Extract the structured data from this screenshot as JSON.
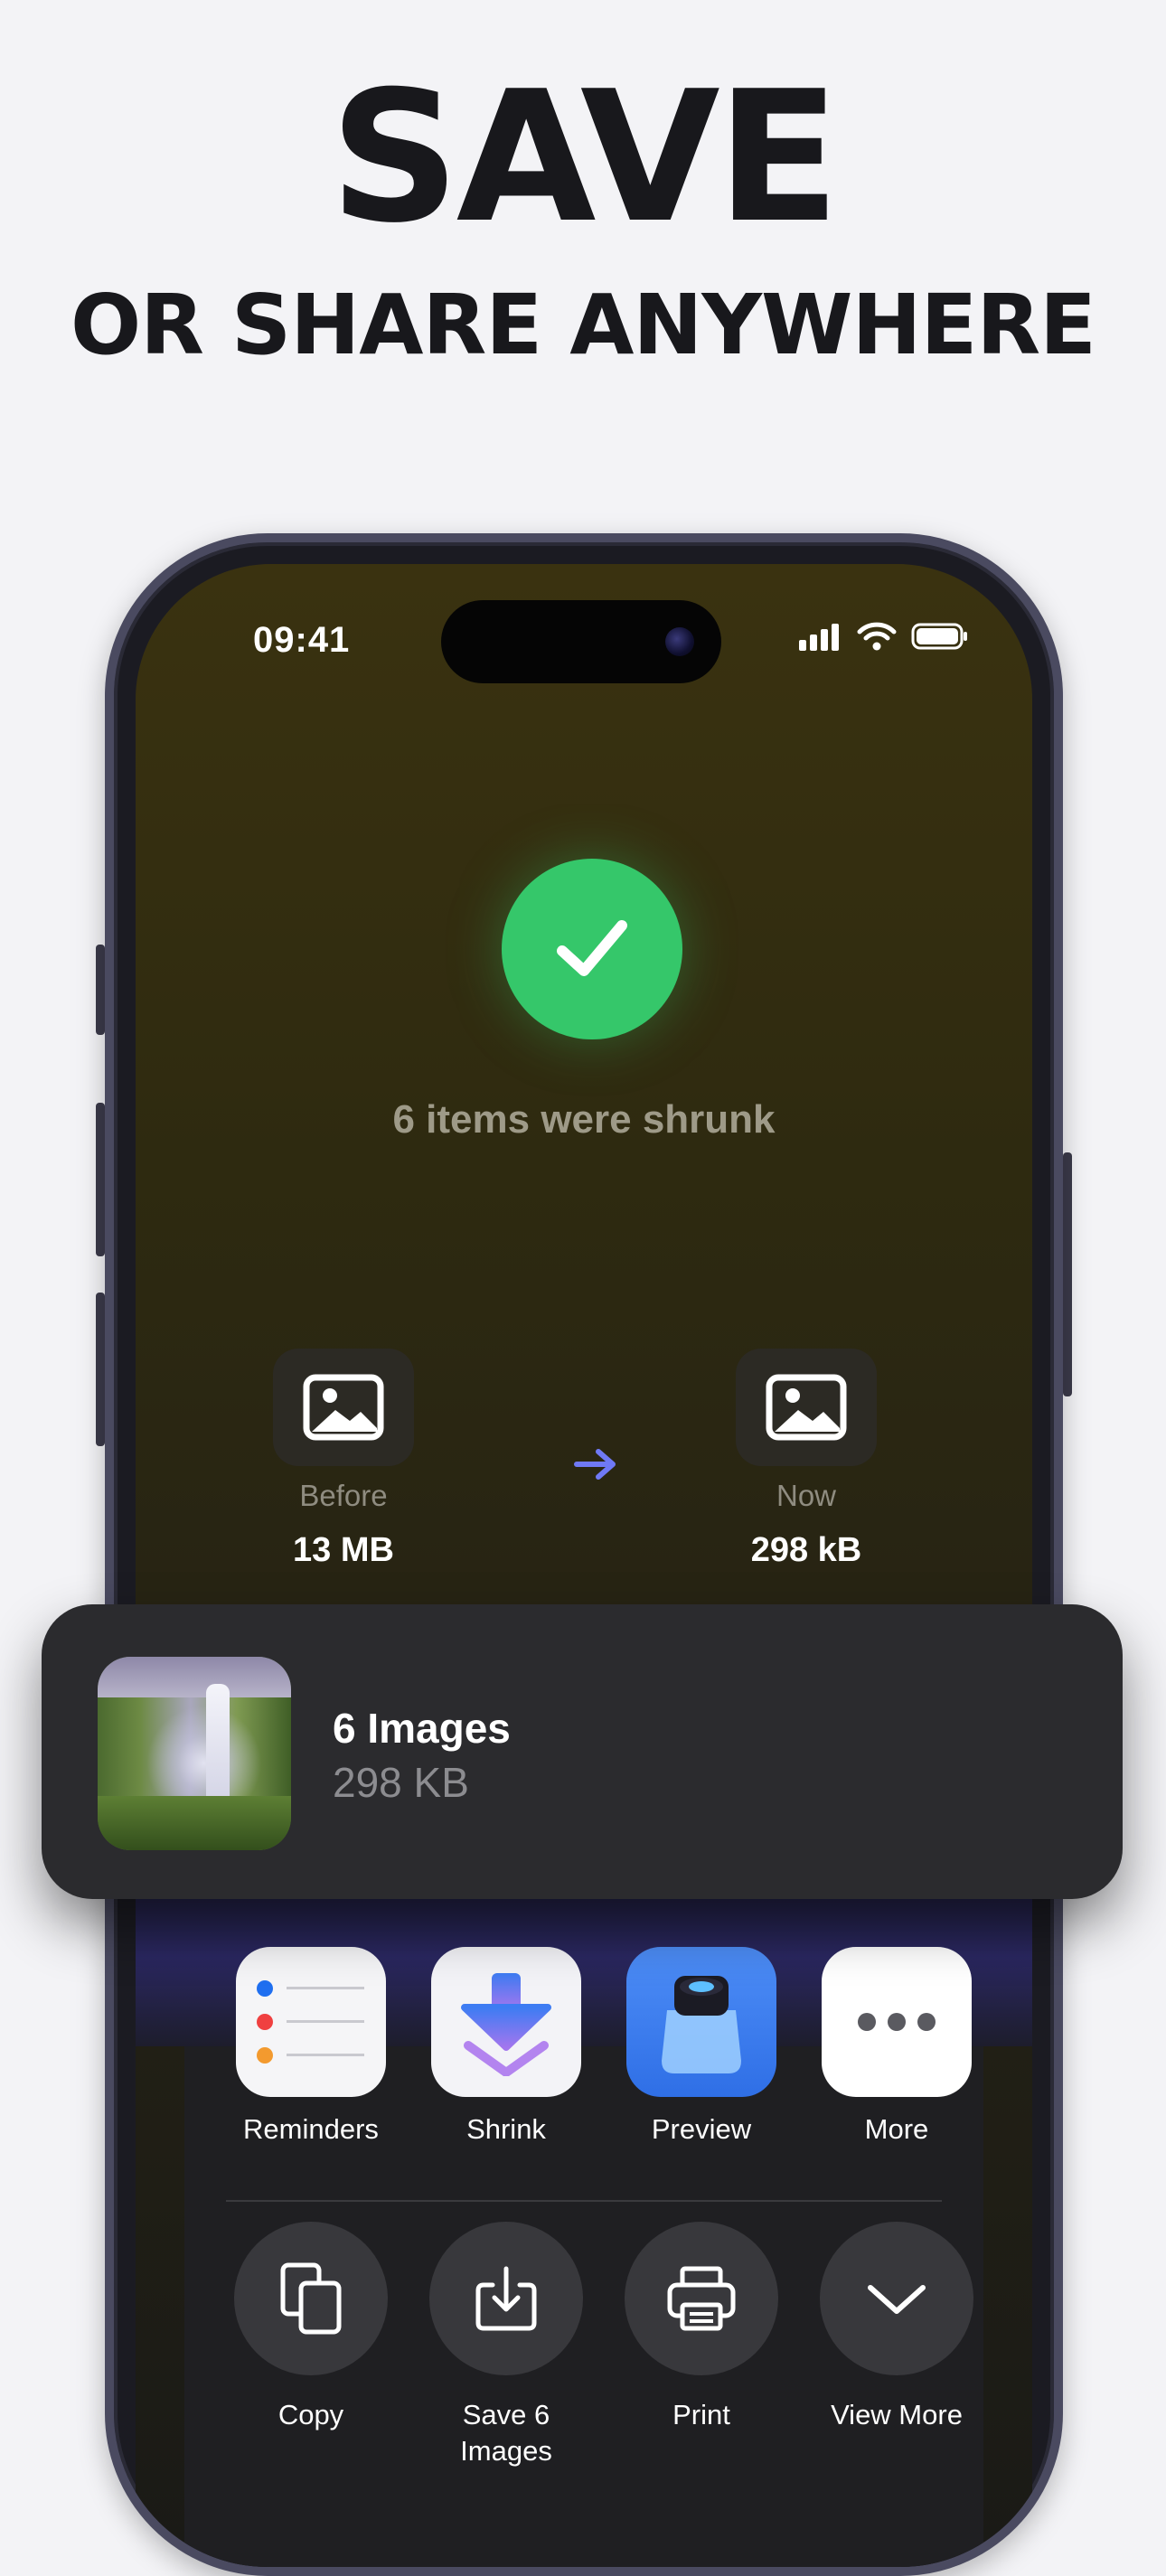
{
  "headline": {
    "title": "SAVE",
    "subtitle": "OR SHARE ANYWHERE"
  },
  "status_bar": {
    "time": "09:41"
  },
  "result": {
    "message": "6 items were shrunk"
  },
  "comparison": {
    "before": {
      "label": "Before",
      "value": "13 MB"
    },
    "now": {
      "label": "Now",
      "value": "298 kB"
    }
  },
  "share_card": {
    "title": "6 Images",
    "size": "298 KB"
  },
  "share_apps": [
    {
      "label": "Reminders",
      "icon": "reminders-icon"
    },
    {
      "label": "Shrink",
      "icon": "shrink-icon"
    },
    {
      "label": "Preview",
      "icon": "preview-icon"
    },
    {
      "label": "More",
      "icon": "more-icon"
    }
  ],
  "share_actions": [
    {
      "label_line1": "Copy",
      "label_line2": "",
      "icon": "copy-icon"
    },
    {
      "label_line1": "Save 6",
      "label_line2": "Images",
      "icon": "save-icon"
    },
    {
      "label_line1": "Print",
      "label_line2": "",
      "icon": "print-icon"
    },
    {
      "label_line1": "View More",
      "label_line2": "",
      "icon": "chevron-down-icon"
    }
  ],
  "colors": {
    "success": "#35c76a",
    "arrow": "#6f79f5",
    "shrink_blue": "#3d7cf3",
    "shrink_purple": "#a276ee"
  }
}
